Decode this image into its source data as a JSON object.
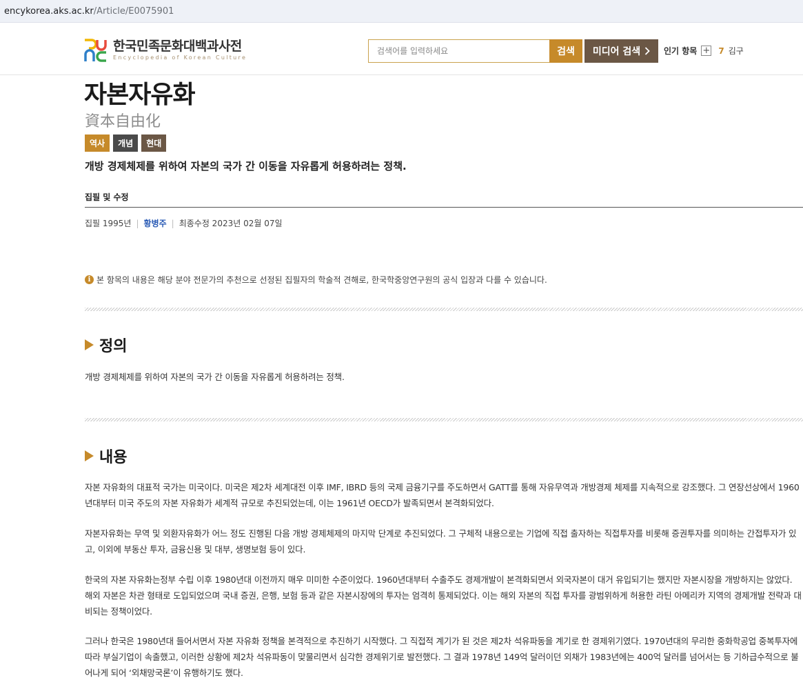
{
  "browser": {
    "url_domain": "encykorea.aks.ac.kr",
    "url_path": "/Article/E0075901"
  },
  "header": {
    "logo_kr": "한국민족문화대백과사전",
    "logo_en": "Encyclopedia of Korean Culture",
    "search_placeholder": "검색어를 입력하세요",
    "search_button": "검색",
    "media_search_button": "미디어 검색",
    "popular_label": "인기 항목",
    "popular_plus": "+",
    "popular_rank": "7",
    "popular_term": "김구"
  },
  "article": {
    "title": "자본자유화",
    "hanja": "資本自由化",
    "tags": [
      "역사",
      "개념",
      "현대"
    ],
    "summary": "개방 경제체제를 위하여 자본의 국가 간 이동을 자유롭게 허용하려는 정책.",
    "edit_heading": "집필 및 수정",
    "written": "집필 1995년",
    "author": "황병주",
    "last_modified": "최종수정 2023년 02월 07일",
    "notice": "본 항목의 내용은 해당 분야 전문가의 추천으로 선정된 집필자의 학술적 견해로, 한국학중앙연구원의 공식 입장과 다를 수 있습니다."
  },
  "sections": {
    "definition_title": "정의",
    "definition_text": "개방 경제체제를 위하여 자본의 국가 간 이동을 자유롭게 허용하려는 정책.",
    "content_title": "내용",
    "content_paragraphs": [
      "자본 자유화의 대표적 국가는 미국이다. 미국은 제2차 세계대전 이후 IMF, IBRD 등의 국제 금융기구를 주도하면서 GATT를 통해 자유무역과 개방경제 체제를 지속적으로 강조했다. 그 연장선상에서 1960년대부터 미국 주도의 자본 자유화가 세계적 규모로 추진되었는데, 이는 1961년 OECD가 발족되면서 본격화되었다.",
      "자본자유화는 무역 및 외환자유화가 어느 정도 진행된 다음 개방 경제체제의 마지막 단계로 추진되었다. 그 구체적 내용으로는 기업에 직접 출자하는 직접투자를 비롯해 증권투자를 의미하는 간접투자가 있고, 이외에 부동산 투자, 금융신용 및 대부, 생명보험 등이 있다.",
      "한국의 자본 자유화는정부 수립 이후 1980년대 이전까지 매우 미미한 수준이었다. 1960년대부터 수출주도 경제개발이 본격화되면서 외국자본이 대거 유입되기는 했지만 자본시장을 개방하지는 않았다. 해외 자본은 차관 형태로 도입되었으며 국내 증권, 은행, 보험 등과 같은 자본시장에의 투자는 엄격히 통제되었다. 이는 해외 자본의 직접 투자를 광범위하게 허용한 라틴 아메리카 지역의 경제개발 전략과 대비되는 정책이었다.",
      "그러나 한국은 1980년대 들어서면서 자본 자유화 정책을 본격적으로 추진하기 시작했다. 그 직접적 계기가 된 것은 제2차 석유파동을 계기로 한 경제위기였다. 1970년대의 무리한 중화학공업 중복투자에 따라 부실기업이 속출했고, 이러한 상황에 제2차 석유파동이 맞물리면서 심각한 경제위기로 발전했다. 그 결과 1978년 149억 달러이던 외채가 1983년에는 400억 달러를 넘어서는 등 기하급수적으로 불어나게 되어 ‘외채망국론’이 유행하기도 했다."
    ]
  },
  "colors": {
    "accent": "#c68a2a",
    "media_button": "#6b5745",
    "author_link": "#2a5bb5"
  }
}
